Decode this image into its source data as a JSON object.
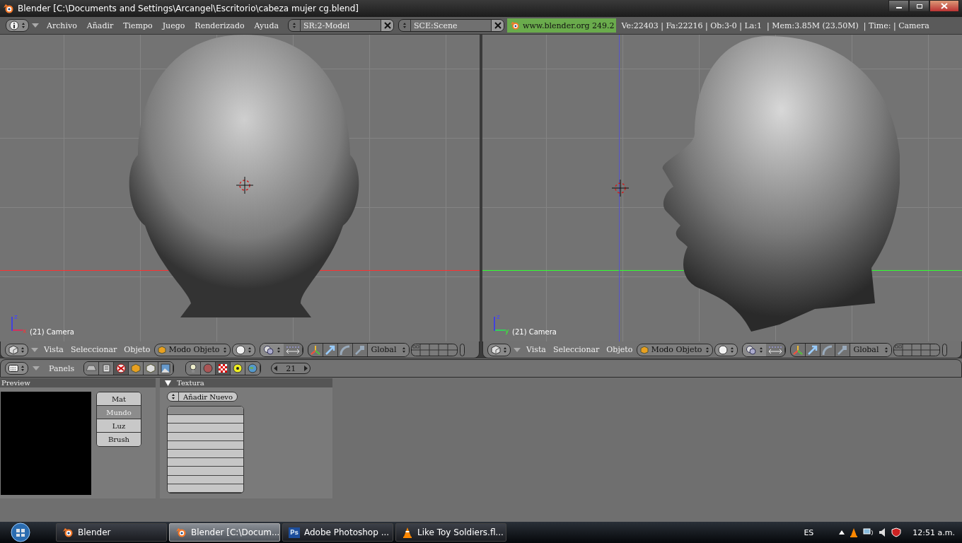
{
  "window": {
    "title": "Blender [C:\\Documents and Settings\\Arcangel\\Escritorio\\cabeza mujer cg.blend]"
  },
  "top_header": {
    "menus": [
      "Archivo",
      "Añadir",
      "Tiempo",
      "Juego",
      "Renderizado",
      "Ayuda"
    ],
    "screen_field": "SR:2-Model",
    "scene_field": "SCE:Scene",
    "version_label": "www.blender.org 249.2",
    "stats": "Ve:22403 | Fa:22216 | Ob:3-0 | La:1  | Mem:3.85M (23.50M)  | Time: | Camera"
  },
  "viewports": [
    {
      "kind": "front",
      "axes": [
        "z",
        "x"
      ],
      "label": "(21) Camera",
      "header": {
        "menus": [
          "Vista",
          "Seleccionar",
          "Objeto"
        ],
        "mode": "Modo Objeto",
        "orientation": "Global"
      }
    },
    {
      "kind": "side",
      "axes": [
        "z",
        "y"
      ],
      "label": "(21) Camera",
      "header": {
        "menus": [
          "Vista",
          "Seleccionar",
          "Objeto"
        ],
        "mode": "Modo Objeto",
        "orientation": "Global"
      }
    }
  ],
  "buttons_window": {
    "menu": "Panels",
    "frame": "21",
    "preview": {
      "title": "Preview",
      "tabs": [
        {
          "label": "Mat",
          "selected": false
        },
        {
          "label": "Mundo",
          "selected": true
        },
        {
          "label": "Luz",
          "selected": false
        },
        {
          "label": "Brush",
          "selected": false
        }
      ]
    },
    "texture": {
      "title": "Textura",
      "expanded": true,
      "add_button": "Añadir Nuevo"
    }
  },
  "taskbar": {
    "tasks": [
      {
        "kind": "blender",
        "label": "Blender",
        "selected": false
      },
      {
        "kind": "blender",
        "label": "Blender [C:\\Docum...",
        "selected": true
      },
      {
        "kind": "photoshop",
        "icon_text": "Ps",
        "label": "Adobe Photoshop ...",
        "selected": false
      },
      {
        "kind": "vlc",
        "label": "Like Toy Soldiers.fl...",
        "selected": false
      }
    ],
    "language": "ES",
    "clock": "12:51 a.m."
  }
}
